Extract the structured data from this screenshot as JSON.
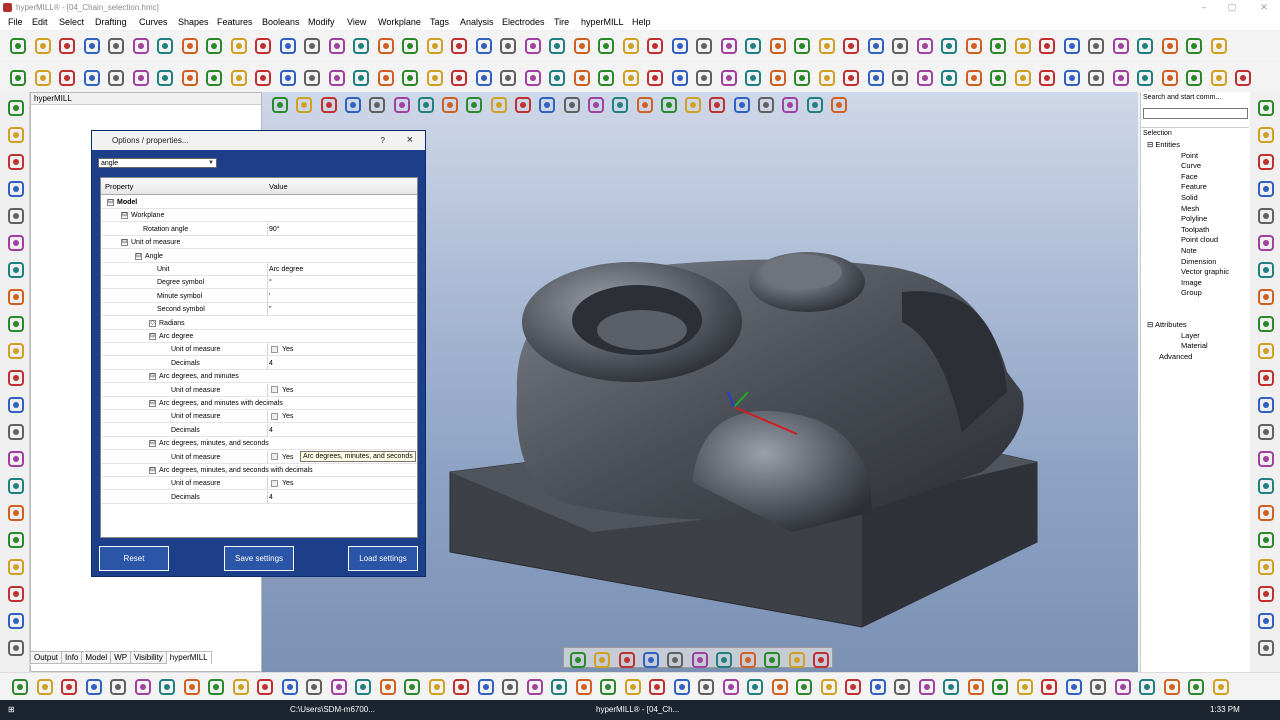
{
  "window": {
    "title": "hyperMILL® - [04_Chain_selection.hmc]"
  },
  "menu": [
    "File",
    "Edit",
    "Select",
    "Drafting",
    "Curves",
    "Shapes",
    "Features",
    "Booleans",
    "Modify",
    "View",
    "Workplane",
    "Tags",
    "Analysis",
    "Electrodes",
    "Tire",
    "hyperMILL",
    "Help"
  ],
  "left_panel": {
    "title": "hyperMILL"
  },
  "bottom_tabs": [
    "Output",
    "Info",
    "Model",
    "WP",
    "Visibility",
    "hyperMILL"
  ],
  "dialog": {
    "title": "Options / properties...",
    "help": "?",
    "close": "×",
    "filter_value": "angle",
    "col_property": "Property",
    "col_value": "Value",
    "rows": [
      {
        "name": "Model",
        "value": "",
        "toggle": "⊟",
        "bold": true
      },
      {
        "name": "Workplane",
        "value": "",
        "toggle": "⊟"
      },
      {
        "name": "Rotation angle",
        "value": "90°",
        "toggle": ""
      },
      {
        "name": "Unit of measure",
        "value": "",
        "toggle": "⊟"
      },
      {
        "name": "Angle",
        "value": "",
        "toggle": "⊟"
      },
      {
        "name": "Unit",
        "value": "Arc degree",
        "toggle": ""
      },
      {
        "name": "Degree symbol",
        "value": "°",
        "toggle": ""
      },
      {
        "name": "Minute symbol",
        "value": "'",
        "toggle": ""
      },
      {
        "name": "Second symbol",
        "value": "\"",
        "toggle": ""
      },
      {
        "name": "Radians",
        "value": "",
        "toggle": "◇"
      },
      {
        "name": "Arc degree",
        "value": "",
        "toggle": "⊟"
      },
      {
        "name": "Unit of measure",
        "value": "Yes",
        "toggle": "",
        "check": true
      },
      {
        "name": "Decimals",
        "value": "4",
        "toggle": ""
      },
      {
        "name": "Arc degrees, and minutes",
        "value": "",
        "toggle": "⊟"
      },
      {
        "name": "Unit of measure",
        "value": "Yes",
        "toggle": "",
        "check": true
      },
      {
        "name": "Arc degrees, and minutes with decimals",
        "value": "",
        "toggle": "⊟"
      },
      {
        "name": "Unit of measure",
        "value": "Yes",
        "toggle": "",
        "check": true
      },
      {
        "name": "Decimals",
        "value": "4",
        "toggle": ""
      },
      {
        "name": "Arc degrees, minutes, and seconds",
        "value": "",
        "toggle": "⊟"
      },
      {
        "name": "Unit of measure",
        "value": "Yes",
        "toggle": "",
        "check": true
      },
      {
        "name": "Arc degrees, minutes, and seconds with decimals",
        "value": "",
        "toggle": "⊟"
      },
      {
        "name": "Unit of measure",
        "value": "Yes",
        "toggle": "",
        "check": true
      },
      {
        "name": "Decimals",
        "value": "4",
        "toggle": ""
      }
    ],
    "tooltip": "Arc degrees, minutes, and seconds",
    "buttons": {
      "reset": "Reset",
      "save": "Save settings",
      "load": "Load settings"
    }
  },
  "right_panel": {
    "search_title": "Search and start comm...",
    "selection_title": "Selection",
    "entities": [
      "Entities",
      "Point",
      "Curve",
      "Face",
      "Feature",
      "Solid",
      "Mesh",
      "Polyline",
      "Toolpath",
      "Point cloud",
      "Note",
      "Dimension",
      "Vector graphic",
      "Image",
      "Group"
    ],
    "attributes": [
      "Attributes",
      "Layer",
      "Material",
      "Advanced"
    ]
  },
  "taskbar": {
    "explorer": "C:\\Users\\SDM-m6700...",
    "app": "hyperMILL® - [04_Ch...",
    "time": "1:33 PM"
  },
  "colors": {
    "dialog_bg": "#1d3f8a",
    "viewport_top": "#cfd8e8",
    "viewport_bottom": "#7b91b4",
    "button": "#2b56a8"
  }
}
